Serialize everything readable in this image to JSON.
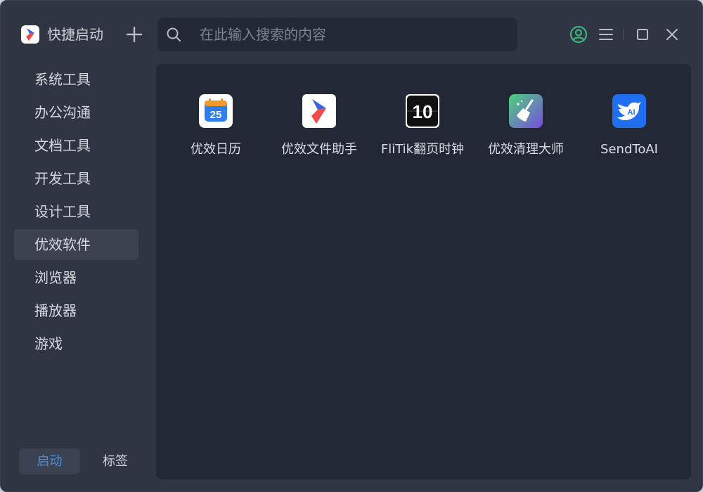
{
  "app": {
    "title": "快捷启动"
  },
  "search": {
    "placeholder": "在此输入搜索的内容",
    "value": ""
  },
  "sidebar": {
    "items": [
      {
        "label": "系统工具"
      },
      {
        "label": "办公沟通"
      },
      {
        "label": "文档工具"
      },
      {
        "label": "开发工具"
      },
      {
        "label": "设计工具"
      },
      {
        "label": "优效软件",
        "active": true
      },
      {
        "label": "浏览器"
      },
      {
        "label": "播放器"
      },
      {
        "label": "游戏"
      }
    ]
  },
  "bottom_tabs": {
    "launch": "启动",
    "tags": "标签"
  },
  "apps": [
    {
      "label": "优效日历",
      "icon": "calendar-icon",
      "badge": "25"
    },
    {
      "label": "优效文件助手",
      "icon": "file-assistant-icon"
    },
    {
      "label": "FliTik翻页时钟",
      "icon": "flip-clock-icon",
      "badge": "10"
    },
    {
      "label": "优效清理大师",
      "icon": "broom-icon"
    },
    {
      "label": "SendToAI",
      "icon": "bird-ai-icon",
      "badge": "AI"
    }
  ],
  "colors": {
    "window_bg": "#2f3543",
    "content_bg": "#222836",
    "accent_blue": "#4f8fd6",
    "user_icon_green": "#3fb27f"
  }
}
